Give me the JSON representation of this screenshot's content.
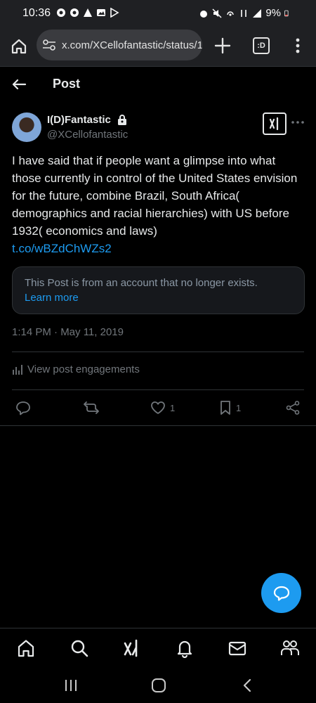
{
  "status_bar": {
    "time": "10:36",
    "battery": "9%"
  },
  "browser": {
    "url": "x.com/XCellofantastic/status/1",
    "tab_label": ":D"
  },
  "header": {
    "title": "Post"
  },
  "post": {
    "display_name": "I(D)Fantastic",
    "handle": "@XCellofantastic",
    "text": "I have said that if people want a glimpse into what those currently in control of the United States envision for the future, combine Brazil, South Africa( demographics and racial hierarchies) with US before 1932( economics and laws)",
    "link": "t.co/wBZdChWZs2",
    "notice": "This Post is from an account that no longer exists.",
    "notice_link": "Learn more",
    "timestamp": "1:14 PM · May 11, 2019",
    "engagements_label": "View post engagements",
    "likes": "1",
    "bookmarks": "1"
  },
  "colors": {
    "background": "#000000",
    "accent": "#1d9bf0",
    "secondary_text": "#71767b",
    "primary_text": "#e7e9ea"
  }
}
